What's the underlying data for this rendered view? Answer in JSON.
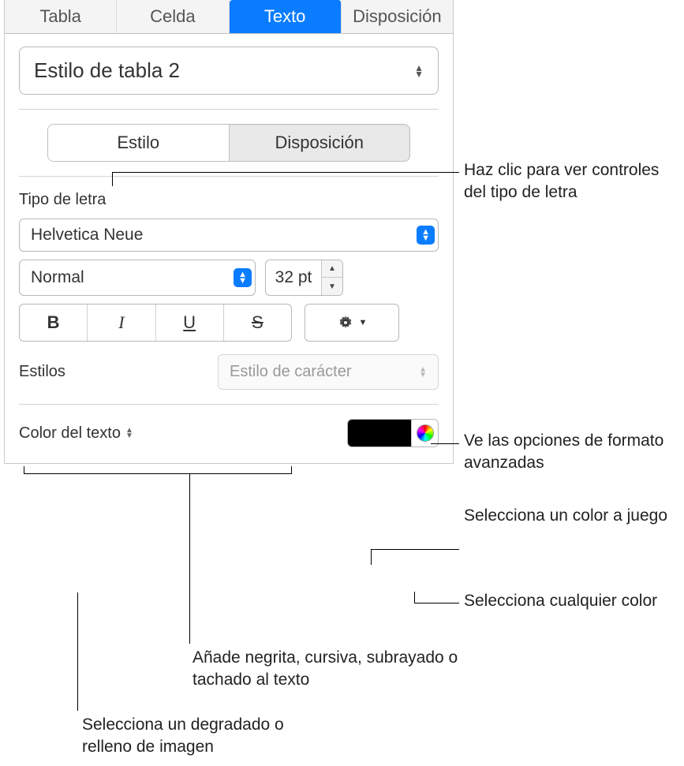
{
  "topbar": {
    "tabs": [
      "Tabla",
      "Celda",
      "Texto",
      "Disposición"
    ],
    "active_index": 2
  },
  "style_dropdown": {
    "value": "Estilo de tabla 2"
  },
  "subsegment": {
    "items": [
      "Estilo",
      "Disposición"
    ],
    "active_index": 0
  },
  "font_section": {
    "label": "Tipo de letra",
    "family": "Helvetica Neue",
    "weight": "Normal",
    "size": "32 pt",
    "bisu": {
      "b": "B",
      "i": "I",
      "u": "U",
      "s": "S"
    },
    "styles_label": "Estilos",
    "char_style_placeholder": "Estilo de carácter"
  },
  "text_color": {
    "label": "Color del texto",
    "swatch": "#000000"
  },
  "callouts": {
    "font_controls": "Haz clic para ver controles del tipo de letra",
    "advanced": "Ve las opciones de formato avanzadas",
    "match_color": "Selecciona un color a juego",
    "any_color": "Selecciona cualquier color",
    "bisu_note": "Añade negrita, cursiva, subrayado o tachado al texto",
    "gradient_note": "Selecciona un degradado o relleno de imagen"
  }
}
